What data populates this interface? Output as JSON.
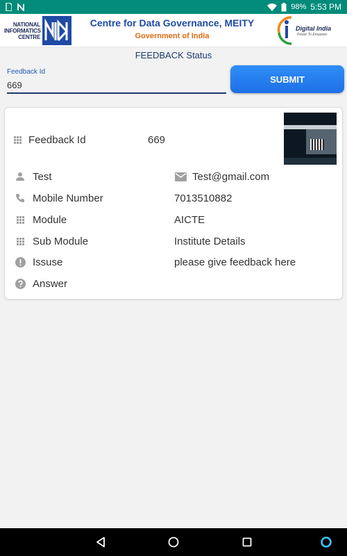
{
  "status_bar": {
    "time": "5:53 PM",
    "battery": "98%",
    "icons": [
      "sd-card-icon",
      "n-icon",
      "wifi-icon",
      "battery-icon"
    ]
  },
  "header": {
    "nic_text": [
      "NATIONAL",
      "INFORMATICS",
      "CENTRE"
    ],
    "title": "Centre for Data Governance, MEITY",
    "subtitle": "Government of India",
    "digital_india": "Digital India",
    "digital_india_tag": "Power To Empower"
  },
  "page": {
    "title": "FEEDBACK Status"
  },
  "form": {
    "label": "Feedback Id",
    "value": "669",
    "submit_label": "SUBMIT"
  },
  "card": {
    "feedback_label": "Feedback Id",
    "feedback_value": "669",
    "name_label": "Test",
    "email_value": "Test@gmail.com",
    "rows": [
      {
        "icon": "phone-icon",
        "label": "Mobile Number",
        "value": "7013510882"
      },
      {
        "icon": "grid-icon",
        "label": "Module",
        "value": "AICTE"
      },
      {
        "icon": "grid-icon",
        "label": "Sub Module",
        "value": "Institute Details"
      },
      {
        "icon": "alert-icon",
        "label": "Issuse",
        "value": "please give feedback here"
      },
      {
        "icon": "help-icon",
        "label": "Answer",
        "value": ""
      }
    ]
  },
  "colors": {
    "status_bar": "#008b7a",
    "accent": "#1e6fe6",
    "title_blue": "#1f4aa5",
    "subtitle_orange": "#e06a12"
  }
}
